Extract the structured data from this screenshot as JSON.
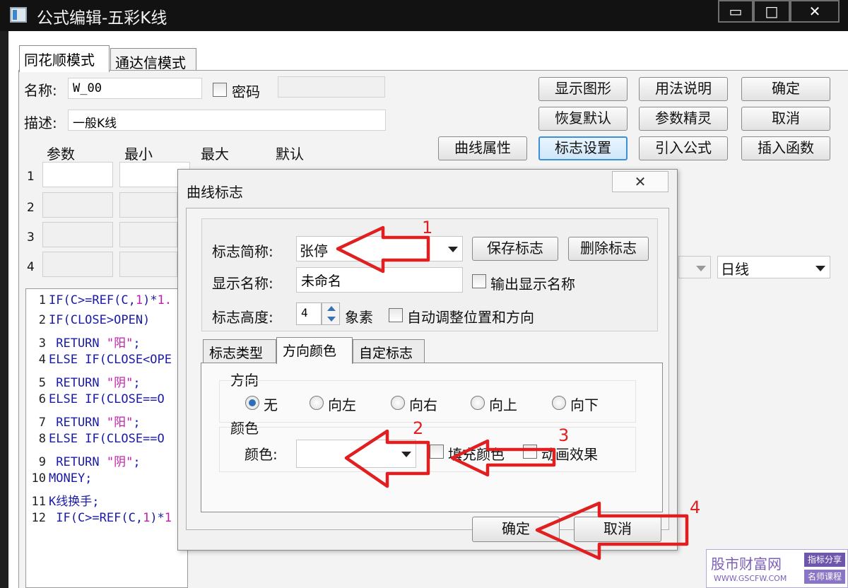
{
  "window": {
    "title": "公式编辑-五彩K线",
    "min_glyph": "▭",
    "max_glyph": "□",
    "close_glyph": "✕"
  },
  "tabs": [
    "同花顺模式",
    "通达信模式"
  ],
  "form": {
    "name_label": "名称:",
    "name_value": "W_00",
    "password_label": "密码",
    "desc_label": "描述:",
    "desc_value": "一般K线"
  },
  "buttons": {
    "show_graph": "显示图形",
    "usage": "用法说明",
    "ok": "确定",
    "restore_default": "恢复默认",
    "param_wizard": "参数精灵",
    "cancel": "取消",
    "curve_props": "曲线属性",
    "marker_settings": "标志设置",
    "import_formula": "引入公式",
    "insert_function": "插入函数"
  },
  "params": {
    "headers": [
      "参数",
      "最小",
      "最大",
      "默认"
    ],
    "rows": [
      "1",
      "2",
      "3",
      "4"
    ]
  },
  "period_select": "日线",
  "code_lines": [
    {
      "n": "1",
      "text": "IF(C>=REF(C,1)*1."
    },
    {
      "n": "2",
      "text": "IF(CLOSE>OPEN)"
    },
    {
      "n": "3",
      "text": " RETURN \"阳\";"
    },
    {
      "n": "4",
      "text": "ELSE IF(CLOSE<OPE"
    },
    {
      "n": "5",
      "text": " RETURN \"阴\";"
    },
    {
      "n": "6",
      "text": "ELSE  IF(CLOSE==O"
    },
    {
      "n": "7",
      "text": " RETURN \"阳\";"
    },
    {
      "n": "8",
      "text": "ELSE  IF(CLOSE==O"
    },
    {
      "n": "9",
      "text": " RETURN \"阴\";"
    },
    {
      "n": "10",
      "text": "MONEY;"
    },
    {
      "n": "11",
      "text": "K线换手;"
    },
    {
      "n": "12",
      "text": " IF(C>=REF(C,1)*1"
    }
  ],
  "dialog": {
    "title": "曲线标志",
    "close_glyph": "✕",
    "abbr_label": "标志简称:",
    "abbr_value": "张停",
    "save_marker": "保存标志",
    "delete_marker": "删除标志",
    "display_name_label": "显示名称:",
    "display_name_value": "未命名",
    "output_display_name": "输出显示名称",
    "height_label": "标志高度:",
    "height_value": "4",
    "height_unit": "象素",
    "auto_adjust": "自动调整位置和方向",
    "tabs": [
      "标志类型",
      "方向颜色",
      "自定标志"
    ],
    "direction_group": "方向",
    "directions": [
      "无",
      "向左",
      "向右",
      "向上",
      "向下"
    ],
    "selected_direction": "无",
    "color_group": "颜色",
    "color_label": "颜色:",
    "fill_color": "填充颜色",
    "animation": "动画效果",
    "ok": "确定",
    "cancel": "取消"
  },
  "annotations": [
    "1",
    "2",
    "3",
    "4"
  ],
  "watermark": {
    "site": "股市财富网",
    "url": "WWW.GSCFW.COM",
    "tag1": "指标分享",
    "tag2": "名师课程"
  },
  "colors": {
    "arrow_red": "#e02020",
    "code_blue": "#1a1aa8",
    "code_string": "#c21ca8",
    "code_number": "#c21ca8",
    "focus_blue": "#3c8fd9"
  }
}
